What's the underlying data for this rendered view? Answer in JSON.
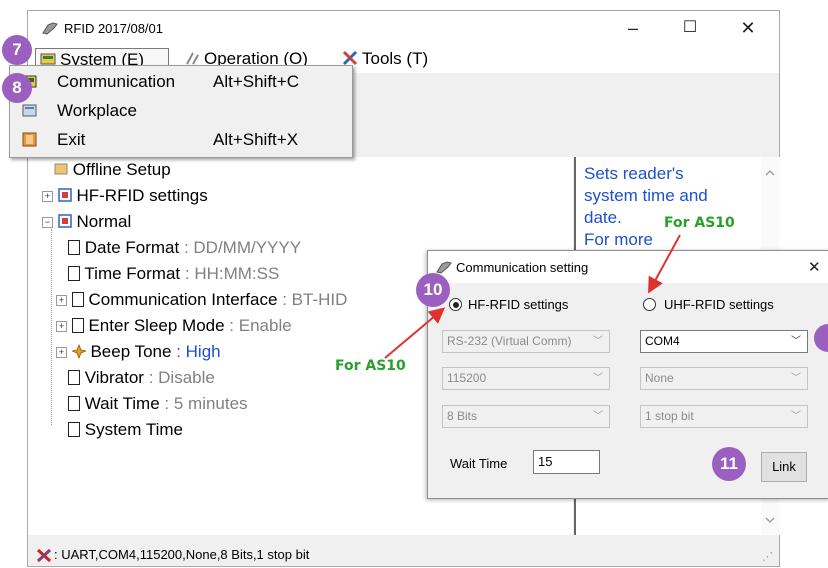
{
  "window": {
    "title": "RFID 2017/08/01",
    "controls": {
      "minimize": "–",
      "maximize": "☐",
      "close": "✕"
    }
  },
  "menubar": [
    {
      "label": "System (E)",
      "icon": "system-icon"
    },
    {
      "label": "Operation (O)",
      "icon": "operation-icon"
    },
    {
      "label": "Tools (T)",
      "icon": "tools-icon"
    }
  ],
  "dropdown": [
    {
      "label": "Communication",
      "shortcut": "Alt+Shift+C",
      "icon": "communication-icon"
    },
    {
      "label": "Workplace",
      "shortcut": "",
      "icon": "workplace-icon"
    },
    {
      "label": "Exit",
      "shortcut": "Alt+Shift+X",
      "icon": "exit-icon"
    }
  ],
  "tree": {
    "offline": "Offline Setup",
    "hf": "HF-RFID settings",
    "normal": "Normal",
    "items": [
      {
        "label": "Date Format",
        "value": ": DD/MM/YYYY"
      },
      {
        "label": "Time Format",
        "value": ": HH:MM:SS"
      },
      {
        "label": "Communication Interface",
        "value": ": BT-HID"
      },
      {
        "label": "Enter Sleep Mode",
        "value": ": Enable"
      },
      {
        "label": "Beep Tone",
        "value": ": High"
      },
      {
        "label": "Vibrator",
        "value": ": Disable"
      },
      {
        "label": "Wait Time",
        "value": ": 5 minutes"
      },
      {
        "label": "System Time",
        "value": ""
      }
    ]
  },
  "help": {
    "line1": "Sets reader's",
    "line2": "system time and",
    "line3": "date.",
    "line4": "For more"
  },
  "status": {
    "text": ": UART,COM4,115200,None,8 Bits,1 stop bit"
  },
  "dialog": {
    "title": "Communication setting",
    "close": "✕",
    "hf_label": "HF-RFID settings",
    "uhf_label": "UHF-RFID settings",
    "hf_port": "RS-232 (Virtual Comm)",
    "hf_baud": "115200",
    "hf_bits": "8 Bits",
    "uhf_port": "COM4",
    "uhf_parity": "None",
    "uhf_stop": "1 stop bit",
    "wait_label": "Wait Time",
    "wait_value": "15",
    "link": "Link",
    "selected": "HF-RFID settings"
  },
  "annotations": {
    "c7": "7",
    "c8": "8",
    "c10": "10",
    "c11": "11",
    "note_left": "For AS10",
    "note_right": "For AS10"
  },
  "colors": {
    "callout": "#9b5fc0",
    "note": "#2aa02a",
    "arrow": "#e03030",
    "help_text": "#1d4fd1"
  }
}
